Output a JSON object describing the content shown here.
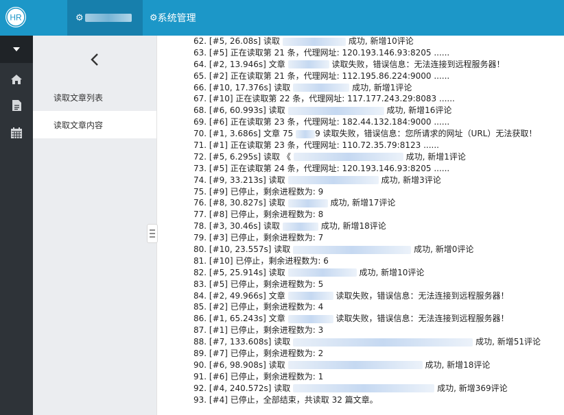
{
  "header": {
    "logo_text": "HR",
    "nav_item_1_label": "",
    "nav_item_2_label": "系统管理",
    "colors": {
      "bar": "#1c97c8",
      "active": "#177fac"
    }
  },
  "rail": {
    "icons": [
      "caret-down-icon",
      "home-icon",
      "document-icon",
      "calendar-icon"
    ]
  },
  "sidebar": {
    "items": [
      {
        "label": "读取文章列表"
      },
      {
        "label": "读取文章内容"
      }
    ]
  },
  "log": {
    "lines": [
      {
        "a": "62. [#5, 26.08s] 读取",
        "b": " 成功, 新增10评论"
      },
      {
        "a": "63. [#5] 正在读取第 21 条，代理网址: 120.193.146.93:8205 ......",
        "b": ""
      },
      {
        "a": "64. [#2, 13.946s] 文章",
        "b": " 读取失败，错误信息：无法连接到远程服务器！"
      },
      {
        "a": "65. [#2] 正在读取第 21 条，代理网址: 112.195.86.224:9000 ......",
        "b": ""
      },
      {
        "a": "66. [#10, 17.376s] 读取",
        "b": " 成功, 新增1评论"
      },
      {
        "a": "67. [#10] 正在读取第 22 条，代理网址: 117.177.243.29:8083 ......",
        "b": ""
      },
      {
        "a": "68. [#6, 60.993s] 读取",
        "b": " 成功, 新增16评论"
      },
      {
        "a": "69. [#6] 正在读取第 23 条，代理网址: 182.44.132.184:9000 ......",
        "b": ""
      },
      {
        "a": "70. [#1, 3.686s] 文章 75",
        "b": "9 读取失败，错误信息：您所请求的网址（URL）无法获取！"
      },
      {
        "a": "71. [#1] 正在读取第 23 条，代理网址: 110.72.35.79:8123 ......",
        "b": ""
      },
      {
        "a": "72. [#5, 6.295s] 读取 《",
        "b": " 成功, 新增1评论"
      },
      {
        "a": "73. [#5] 正在读取第 24 条，代理网址: 120.193.146.93:8205 ......",
        "b": ""
      },
      {
        "a": "74. [#9, 33.213s] 读取",
        "b": " 成功, 新增3评论"
      },
      {
        "a": "75. [#9] 已停止，剩余进程数为: 9",
        "b": ""
      },
      {
        "a": "76. [#8, 30.827s] 读取",
        "b": " 成功, 新增17评论"
      },
      {
        "a": "77. [#8] 已停止，剩余进程数为: 8",
        "b": ""
      },
      {
        "a": "78. [#3, 30.46s] 读取",
        "b": " 成功, 新增18评论"
      },
      {
        "a": "79. [#3] 已停止，剩余进程数为: 7",
        "b": ""
      },
      {
        "a": "80. [#10, 23.557s] 读取",
        "b": " 成功, 新增0评论"
      },
      {
        "a": "81. [#10] 已停止，剩余进程数为: 6",
        "b": ""
      },
      {
        "a": "82. [#5, 25.914s] 读取",
        "b": " 成功, 新增10评论"
      },
      {
        "a": "83. [#5] 已停止，剩余进程数为: 5",
        "b": ""
      },
      {
        "a": "84. [#2, 49.966s] 文章",
        "b": " 读取失败，错误信息：无法连接到远程服务器！"
      },
      {
        "a": "85. [#2] 已停止，剩余进程数为: 4",
        "b": ""
      },
      {
        "a": "86. [#1, 65.243s] 文章",
        "b": " 读取失败，错误信息：无法连接到远程服务器！"
      },
      {
        "a": "87. [#1] 已停止，剩余进程数为: 3",
        "b": ""
      },
      {
        "a": "88. [#7, 133.608s] 读取",
        "b": " 成功, 新增51评论"
      },
      {
        "a": "89. [#7] 已停止，剩余进程数为: 2",
        "b": ""
      },
      {
        "a": "90. [#6, 98.908s] 读取",
        "b": " 成功, 新增18评论"
      },
      {
        "a": "91. [#6] 已停止，剩余进程数为: 1",
        "b": ""
      },
      {
        "a": "92. [#4, 240.572s] 读取",
        "b": " 成功, 新增369评论"
      },
      {
        "a": "93. [#4] 已停止，全部结束，共读取 32 篇文章。",
        "b": ""
      }
    ]
  }
}
